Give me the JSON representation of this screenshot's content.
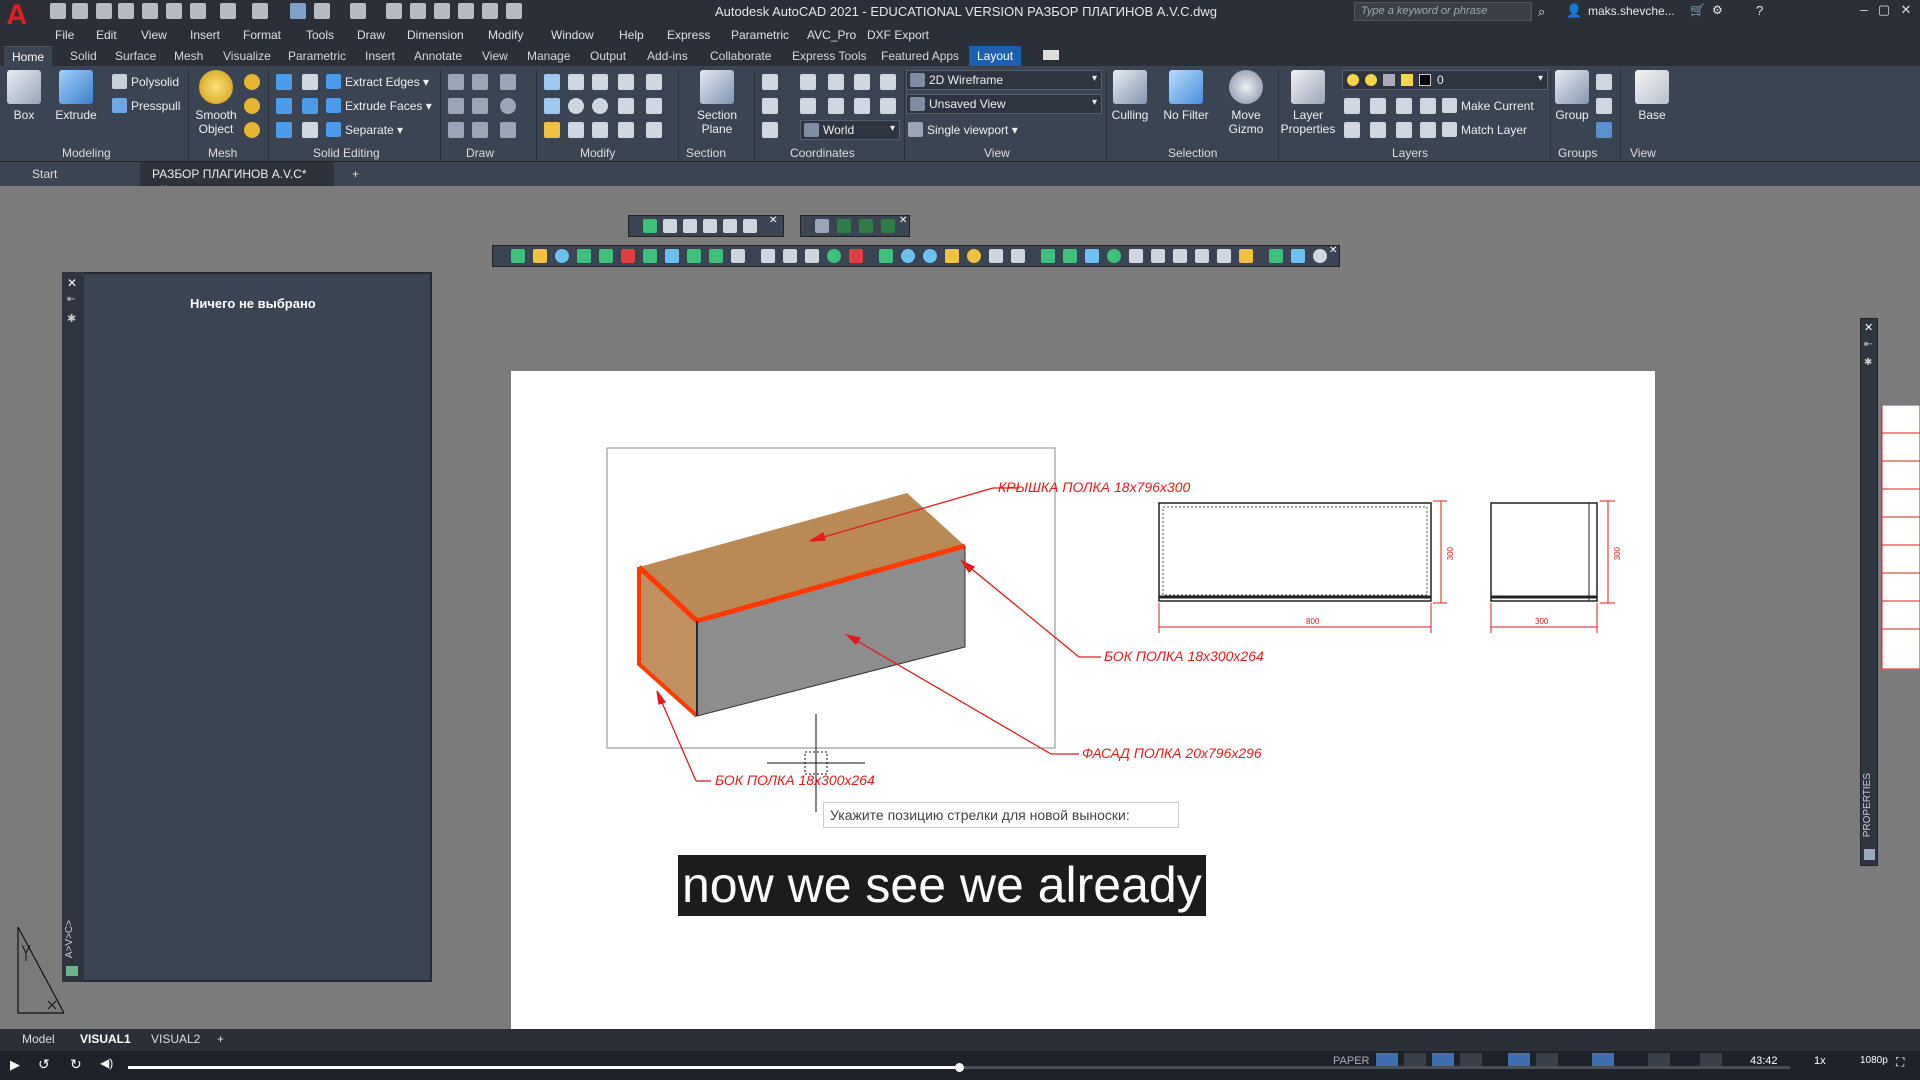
{
  "app": {
    "title": "Autodesk AutoCAD 2021 - EDUCATIONAL VERSION   РАЗБОР ПЛАГИНОВ A.V.C.dwg",
    "search_placeholder": "Type a keyword or phrase",
    "user": "maks.shevche..."
  },
  "menu": [
    "File",
    "Edit",
    "View",
    "Insert",
    "Format",
    "Tools",
    "Draw",
    "Dimension",
    "Modify",
    "Window",
    "Help",
    "Express",
    "Parametric",
    "AVC_Pro",
    "DXF Export"
  ],
  "ribbon_tabs": [
    "Home",
    "Solid",
    "Surface",
    "Mesh",
    "Visualize",
    "Parametric",
    "Insert",
    "Annotate",
    "View",
    "Manage",
    "Output",
    "Add-ins",
    "Collaborate",
    "Express Tools",
    "Featured Apps",
    "Layout"
  ],
  "ribbon": {
    "modeling": {
      "box": "Box",
      "extrude": "Extrude",
      "polysolid": "Polysolid",
      "presspull": "Presspull",
      "title": "Modeling"
    },
    "mesh": {
      "smooth": "Smooth\nObject",
      "title": "Mesh"
    },
    "solid_editing": {
      "extract_edges": "Extract Edges",
      "extrude_faces": "Extrude Faces",
      "separate": "Separate",
      "title": "Solid Editing"
    },
    "draw_title": "Draw",
    "modify_title": "Modify",
    "section": {
      "plane": "Section\nPlane",
      "title": "Section"
    },
    "coordinates": {
      "world": "World",
      "title": "Coordinates"
    },
    "view": {
      "visual_style": "2D Wireframe",
      "named_view": "Unsaved View",
      "viewport": "Single viewport",
      "title": "View"
    },
    "selection": {
      "culling": "Culling",
      "no_filter": "No Filter",
      "move_gizmo": "Move\nGizmo",
      "title": "Selection"
    },
    "layers": {
      "layer_props": "Layer\nProperties",
      "current_layer": "0",
      "make_current": "Make Current",
      "match_layer": "Match Layer",
      "title": "Layers"
    },
    "groups": {
      "group": "Group",
      "title": "Groups"
    },
    "view2": {
      "base": "Base",
      "title": "View"
    }
  },
  "file_tabs": {
    "start": "Start",
    "doc": "РАЗБОР ПЛАГИНОВ A.V.C*",
    "close": "×",
    "add": "+"
  },
  "properties_panel": {
    "title": "Ничего не выбрано",
    "side_label": "A>V>C>"
  },
  "drawing": {
    "label_top": "КРЫШКА ПОЛКА 18x796x300",
    "label_side_right": "БОК ПОЛКА 18x300x264",
    "label_front": "ФАСАД ПОЛКА 20x796x296",
    "label_side_left": "БОК ПОЛКА 18x300x264",
    "dim_width": "800",
    "dim_height": "300",
    "dim_depth": "300"
  },
  "command_tip": "Укажите позицию стрелки для новой выноски:",
  "subtitle": "now we see we already",
  "right_panel_label": "PROPERTIES",
  "layout_tabs": [
    "Model",
    "VISUAL1",
    "VISUAL2",
    "+"
  ],
  "status": {
    "paper": "PAPER",
    "time": "43:42",
    "speed": "1x",
    "quality": "1080p"
  },
  "video": {
    "progress": 0.5
  }
}
